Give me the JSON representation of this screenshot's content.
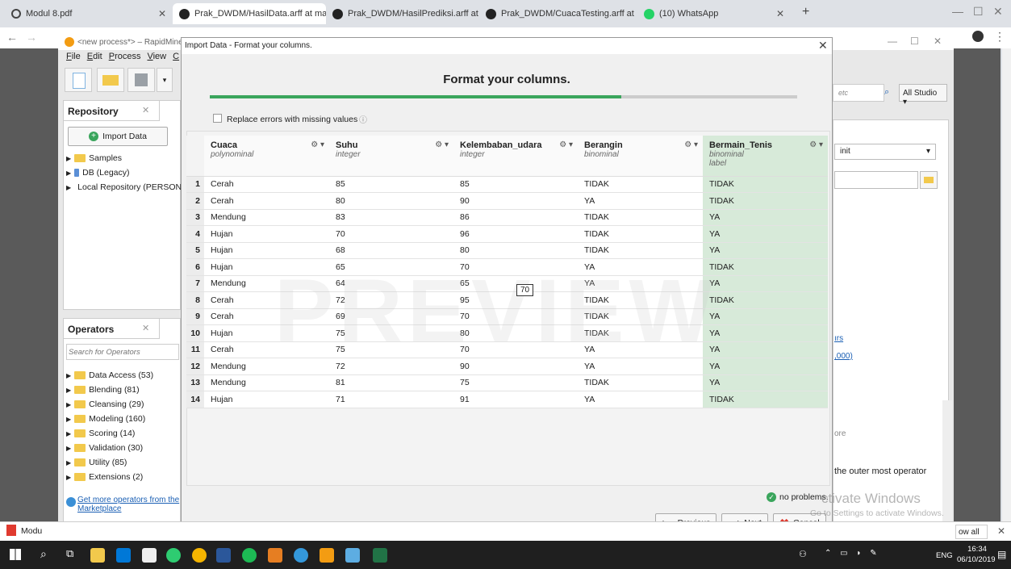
{
  "browser": {
    "tabs": [
      {
        "label": "Modul 8.pdf"
      },
      {
        "label": "Prak_DWDM/HasilData.arff at ma"
      },
      {
        "label": "Prak_DWDM/HasilPrediksi.arff at"
      },
      {
        "label": "Prak_DWDM/CuacaTesting.arff at"
      },
      {
        "label": "(10) WhatsApp"
      }
    ],
    "new_tab": "+"
  },
  "rapidminer": {
    "title": "<new process*> – RapidMine",
    "menu": [
      "File",
      "Edit",
      "Process",
      "View",
      "C"
    ],
    "search_placeholder": "etc",
    "studio_label": "All Studio ▾",
    "repository": {
      "title": "Repository",
      "import_button": "Import Data",
      "items": [
        "Samples",
        "DB (Legacy)",
        "Local Repository (PERSON"
      ]
    },
    "operators": {
      "title": "Operators",
      "search_placeholder": "Search for Operators",
      "items": [
        "Data Access (53)",
        "Blending (81)",
        "Cleansing (29)",
        "Modeling (160)",
        "Scoring (14)",
        "Validation (30)",
        "Utility (85)",
        "Extensions (2)"
      ],
      "marketplace_link": "Get more operators from the Marketplace"
    },
    "right_panel": {
      "dropdown_value": "init",
      "link1": "ırs",
      "link2": ",000)",
      "text1": "ore",
      "text2": "the outer most operator",
      "show_all": "ow all"
    }
  },
  "dialog": {
    "title": "Import Data - Format your columns.",
    "heading": "Format your columns.",
    "progress_fraction": 0.7,
    "replace_errors_label": "Replace errors with missing values",
    "watermark": "PREVIEW",
    "hover_cell": "70",
    "columns": [
      {
        "name": "Cuaca",
        "type": "polynominal",
        "role": ""
      },
      {
        "name": "Suhu",
        "type": "integer",
        "role": ""
      },
      {
        "name": "Kelembaban_udara",
        "type": "integer",
        "role": ""
      },
      {
        "name": "Berangin",
        "type": "binominal",
        "role": ""
      },
      {
        "name": "Bermain_Tenis",
        "type": "binominal",
        "role": "label"
      }
    ],
    "rows": [
      [
        "1",
        "Cerah",
        "85",
        "85",
        "TIDAK",
        "TIDAK"
      ],
      [
        "2",
        "Cerah",
        "80",
        "90",
        "YA",
        "TIDAK"
      ],
      [
        "3",
        "Mendung",
        "83",
        "86",
        "TIDAK",
        "YA"
      ],
      [
        "4",
        "Hujan",
        "70",
        "96",
        "TIDAK",
        "YA"
      ],
      [
        "5",
        "Hujan",
        "68",
        "80",
        "TIDAK",
        "YA"
      ],
      [
        "6",
        "Hujan",
        "65",
        "70",
        "YA",
        "TIDAK"
      ],
      [
        "7",
        "Mendung",
        "64",
        "65",
        "YA",
        "YA"
      ],
      [
        "8",
        "Cerah",
        "72",
        "95",
        "TIDAK",
        "TIDAK"
      ],
      [
        "9",
        "Cerah",
        "69",
        "70",
        "TIDAK",
        "YA"
      ],
      [
        "10",
        "Hujan",
        "75",
        "80",
        "TIDAK",
        "YA"
      ],
      [
        "11",
        "Cerah",
        "75",
        "70",
        "YA",
        "YA"
      ],
      [
        "12",
        "Mendung",
        "72",
        "90",
        "YA",
        "YA"
      ],
      [
        "13",
        "Mendung",
        "81",
        "75",
        "TIDAK",
        "YA"
      ],
      [
        "14",
        "Hujan",
        "71",
        "91",
        "YA",
        "TIDAK"
      ]
    ],
    "status": "no problems.",
    "buttons": {
      "previous": "Previous",
      "next": "Next",
      "cancel": "Cancel"
    },
    "overlay": {
      "activate_title": "ctivate Windows",
      "activate_sub": "Go to Settings to activate Windows."
    }
  },
  "taskbar": {
    "time": "16:34",
    "date": "06/10/2019",
    "lang": "ENG",
    "bottom_tab": "Modu"
  },
  "colors": {
    "accent": "#3aa55c",
    "label_col": "#d7ead9",
    "taskbar": "#1f1f1f"
  }
}
